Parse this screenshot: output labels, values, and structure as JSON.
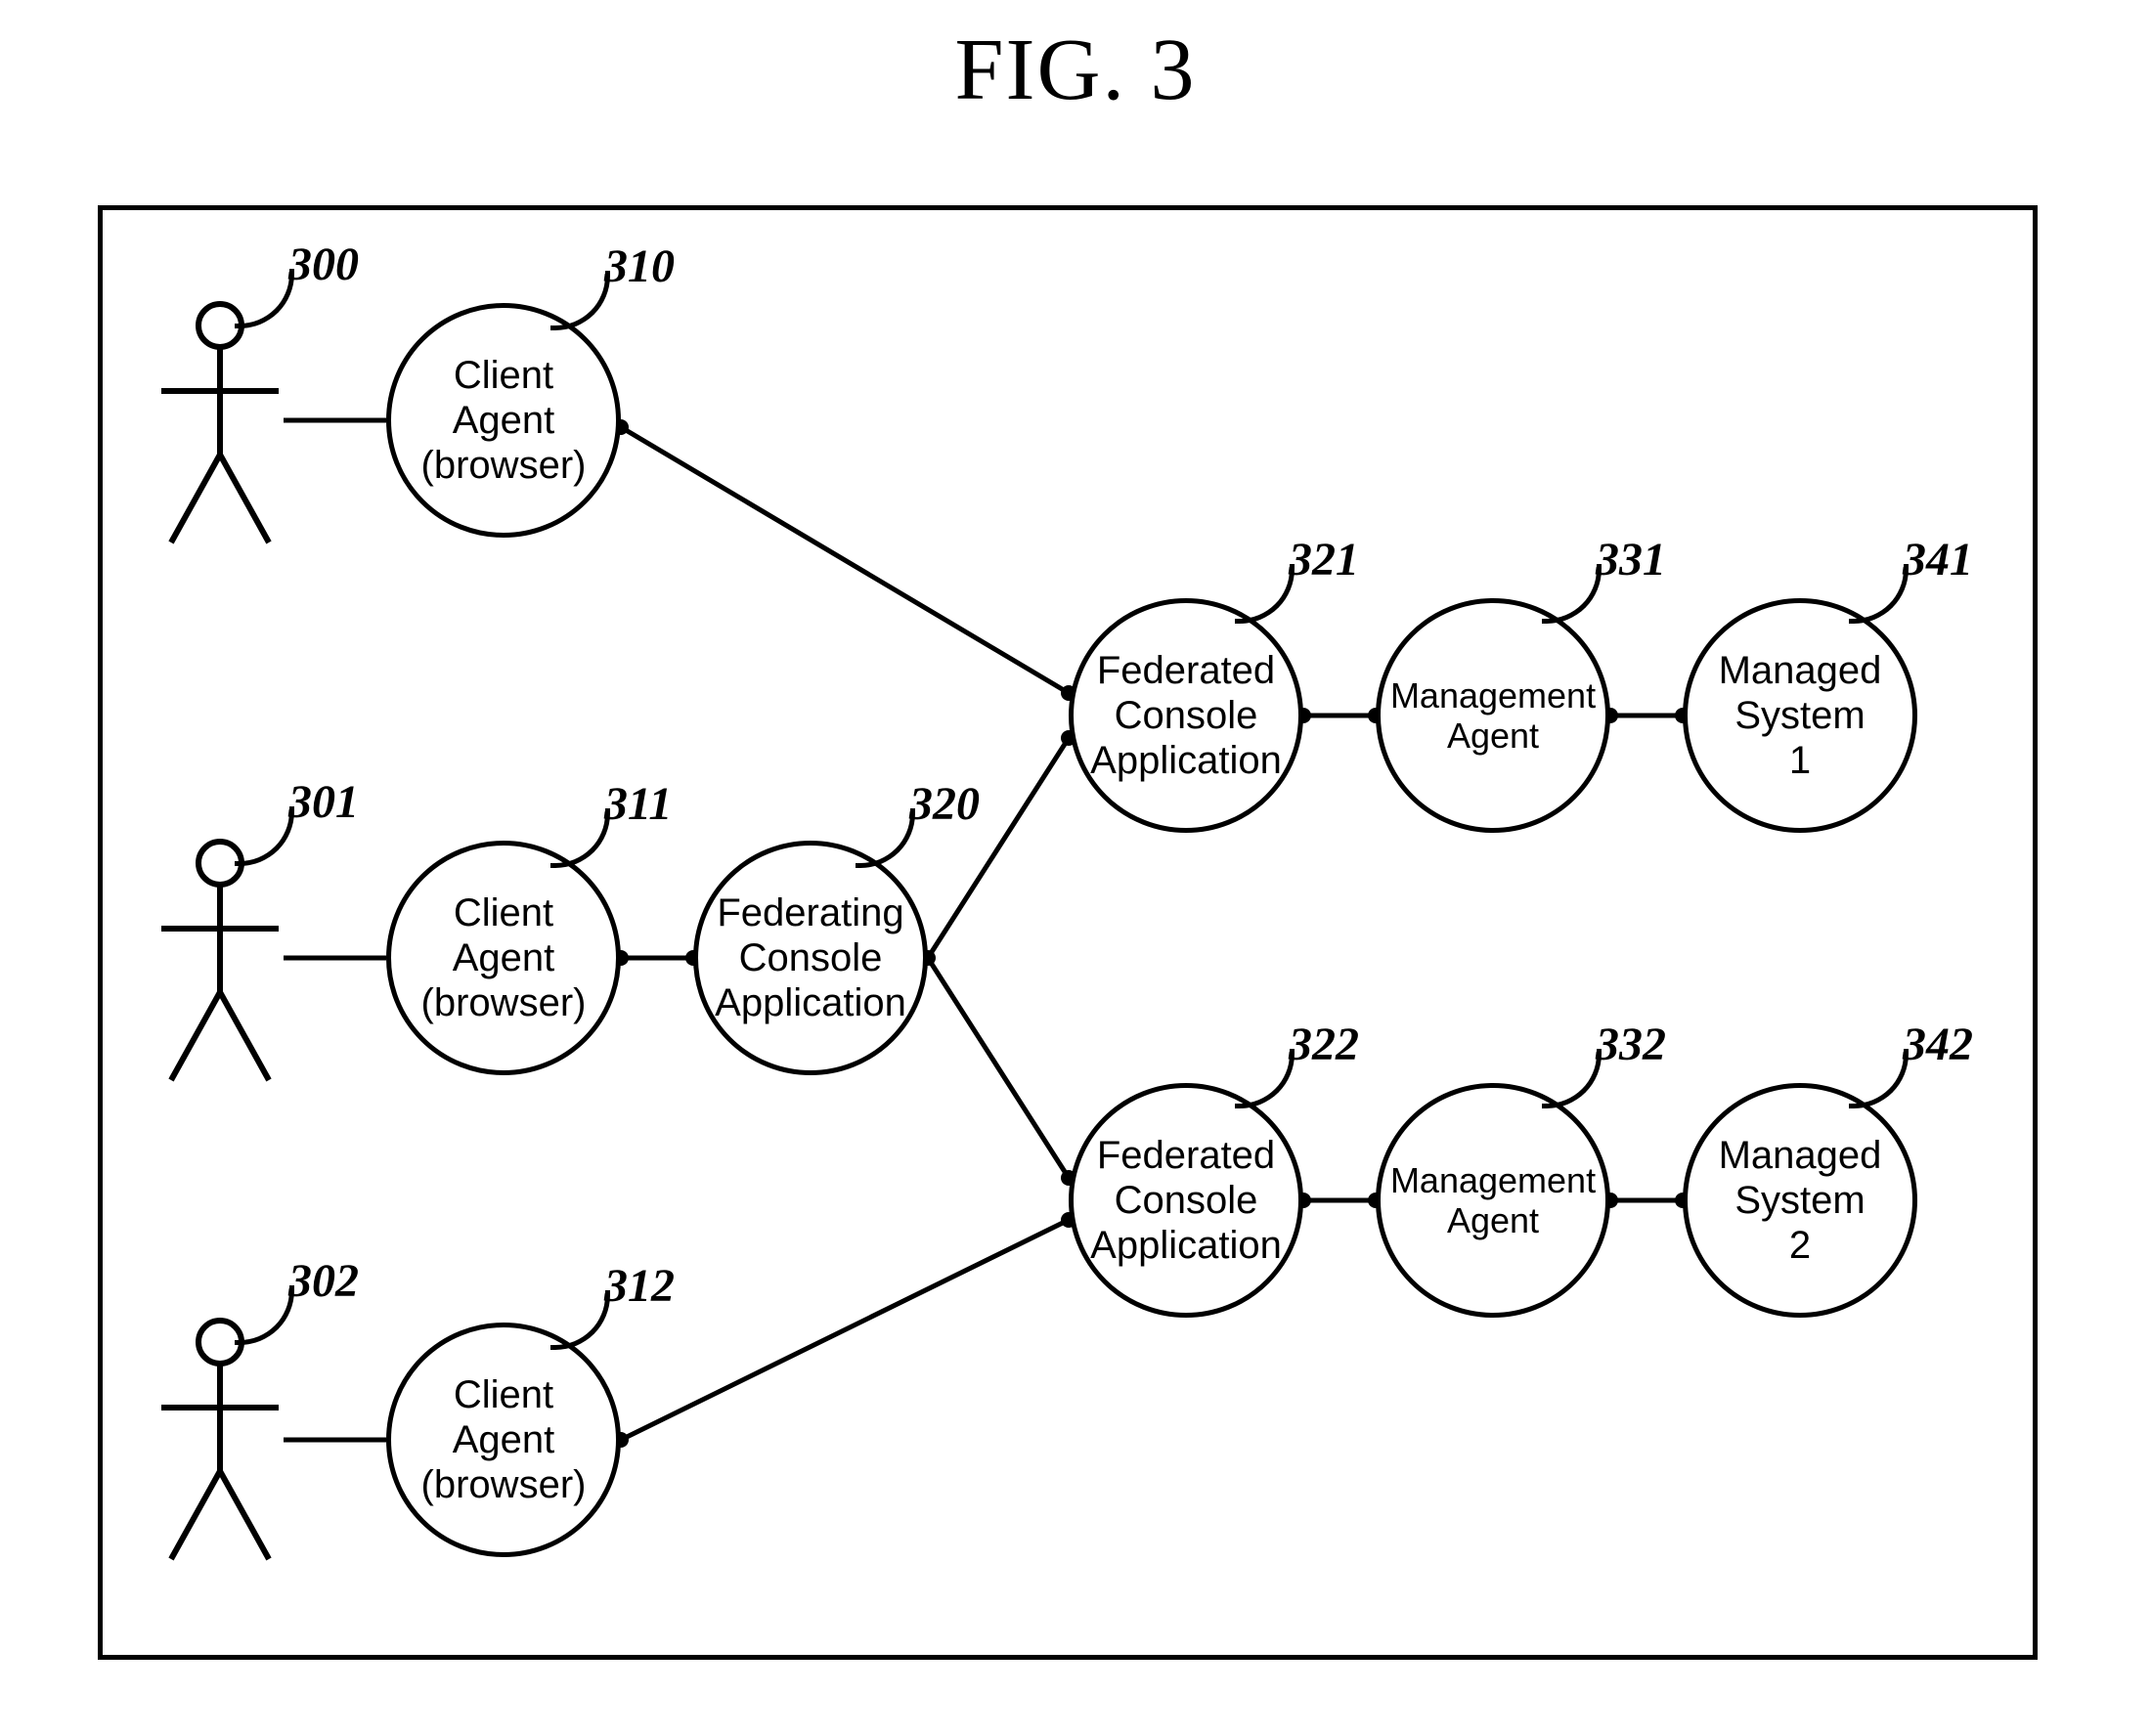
{
  "figure_title": "FIG. 3",
  "nodes": {
    "n310": {
      "label": "Client\nAgent\n(browser)",
      "ref": "310"
    },
    "n311": {
      "label": "Client\nAgent\n(browser)",
      "ref": "311"
    },
    "n312": {
      "label": "Client\nAgent\n(browser)",
      "ref": "312"
    },
    "n320": {
      "label": "Federating\nConsole\nApplication",
      "ref": "320"
    },
    "n321": {
      "label": "Federated\nConsole\nApplication",
      "ref": "321"
    },
    "n322": {
      "label": "Federated\nConsole\nApplication",
      "ref": "322"
    },
    "n331": {
      "label": "Management\nAgent",
      "ref": "331"
    },
    "n332": {
      "label": "Management\nAgent",
      "ref": "332"
    },
    "n341": {
      "label": "Managed\nSystem\n1",
      "ref": "341"
    },
    "n342": {
      "label": "Managed\nSystem\n2",
      "ref": "342"
    }
  },
  "actors": {
    "a300": {
      "ref": "300"
    },
    "a301": {
      "ref": "301"
    },
    "a302": {
      "ref": "302"
    }
  }
}
